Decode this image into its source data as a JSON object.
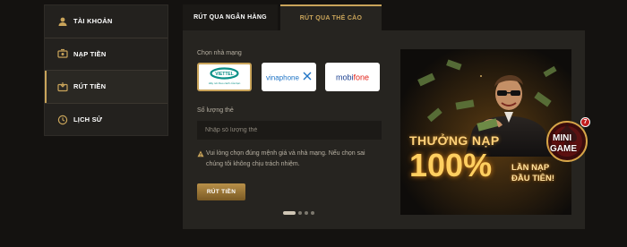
{
  "sidebar": {
    "items": [
      {
        "label": "TÀI KHOẢN",
        "icon": "user-icon",
        "active": false
      },
      {
        "label": "NẠP TIỀN",
        "icon": "deposit-icon",
        "active": false
      },
      {
        "label": "RÚT TIỀN",
        "icon": "withdraw-icon",
        "active": true
      },
      {
        "label": "LỊCH SỬ",
        "icon": "history-icon",
        "active": false
      }
    ]
  },
  "tabs": [
    {
      "label": "RÚT QUA NGÂN HÀNG",
      "active": false
    },
    {
      "label": "RÚT QUA THẺ CÀO",
      "active": true
    }
  ],
  "form": {
    "network_label": "Chọn nhà mạng",
    "networks": [
      {
        "name": "viettel",
        "tagline": "Hãy nói theo cách của bạn",
        "selected": true
      },
      {
        "name": "vinaphone",
        "selected": false
      },
      {
        "name": "mobifone",
        "selected": false
      }
    ],
    "quantity_label": "Số lượng thẻ",
    "quantity_placeholder": "Nhập số lượng thẻ",
    "quantity_value": "",
    "note": "Vui lòng chọn đúng mệnh giá và nhà mạng. Nếu chọn sai chúng tôi không chịu trách nhiệm.",
    "submit_label": "RÚT TIỀN"
  },
  "banner": {
    "title": "THƯỞNG NẠP",
    "percent": "100%",
    "subtitle_line1": "LẦN NẠP",
    "subtitle_line2": "ĐẦU TIÊN!",
    "slide_count": 4,
    "active_slide": 1
  },
  "badge": {
    "line1": "MINI",
    "line2": "GAME",
    "count": "7"
  },
  "colors": {
    "accent": "#c9a45a",
    "panel": "#262420",
    "page": "#141210",
    "viettel": "#0a8f86",
    "vinaphone": "#1f74c6",
    "mobifone": "#e2231a"
  }
}
